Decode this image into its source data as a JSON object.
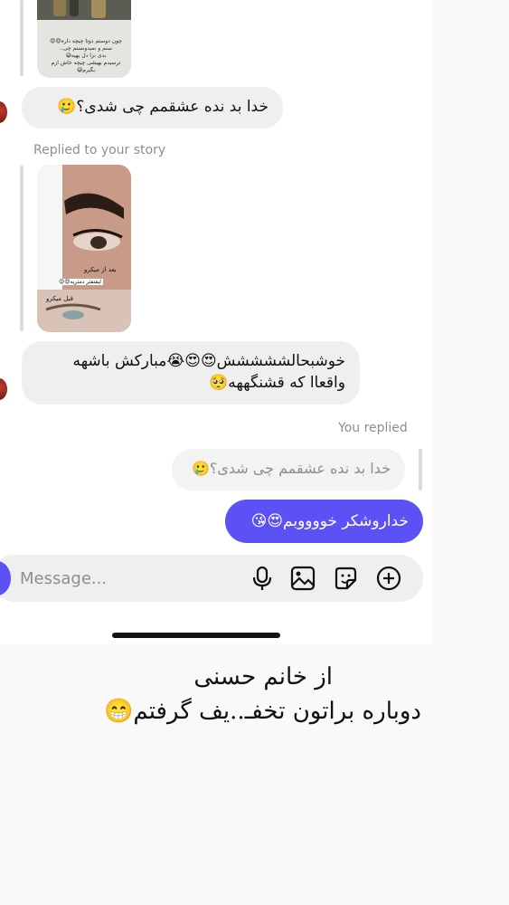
{
  "messages": {
    "story_reply_caption": "Replied to your story",
    "incoming_1": "خدا بد نده عشقمم چی شدی؟🥲",
    "incoming_2_line1": "خوشبحالششششش😍😍😭مبارکش باشهه",
    "incoming_2_line2": "واقعاا که قشنگههه🥺",
    "you_replied_caption": "You replied",
    "quoted_reply": "خدا بد نده عشقمم چی شدی؟🥲",
    "outgoing_1": "خداروشکر خووووبم😍😘"
  },
  "story_1": {
    "caption_lines": [
      "چون دوستم دوتا چیچه داره😍😍",
      "سنم و نمیدونستم چی..",
      "بدی نزا دل بهیه😅",
      "ترسیدم بهیشی چیچه خاش ازم بگیرم😅"
    ]
  },
  "story_2": {
    "label_after": "بعد از میکرو",
    "label_lash": "لیفتفثر دمثریه😍😍",
    "label_before": "قبل میکرو"
  },
  "composer": {
    "placeholder": "Message..."
  },
  "icons": {
    "mic": "mic-icon",
    "gallery": "image-icon",
    "sticker": "sticker-icon",
    "add": "plus-circle-icon",
    "camera": "camera-icon"
  },
  "overlay": {
    "line1": "از خانم حسنی",
    "line2": "دوباره براتون تخفـ..یف گرفتم😁"
  },
  "colors": {
    "accent": "#5b51f5",
    "incoming_bubble": "#efefef",
    "reply_bubble": "#f3f3f3"
  }
}
